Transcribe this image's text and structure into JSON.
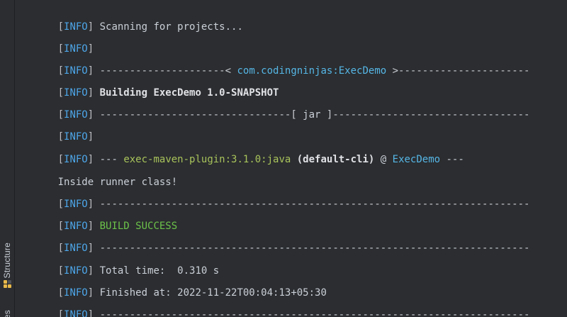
{
  "sidebar": {
    "structure_label": "Structure",
    "partial_label": "es"
  },
  "console": {
    "lines": [
      {
        "tag": "INFO",
        "text": "Scanning for projects..."
      },
      {
        "tag": "INFO"
      },
      {
        "tag": "INFO",
        "dashes_before": "---------------------< ",
        "coord": "com.codingninjas:ExecDemo",
        "dashes_after": " >----------------------"
      },
      {
        "tag": "INFO",
        "bold": "Building ExecDemo 1.0-SNAPSHOT"
      },
      {
        "tag": "INFO",
        "dashes_before": "--------------------------------[ ",
        "packaging": "jar",
        "dashes_after": " ]---------------------------------"
      },
      {
        "tag": "INFO"
      },
      {
        "tag": "INFO",
        "prefix": "--- ",
        "plugin": "exec-maven-plugin:3.1.0:java",
        "execution": " (default-cli)",
        "at": " @ ",
        "project": "ExecDemo",
        "suffix": " ---"
      },
      {
        "text": "Inside runner class!"
      },
      {
        "tag": "INFO",
        "dashes": "------------------------------------------------------------------------"
      },
      {
        "tag": "INFO",
        "status": "BUILD SUCCESS"
      },
      {
        "tag": "INFO",
        "dashes": "------------------------------------------------------------------------"
      },
      {
        "tag": "INFO",
        "text": "Total time:  0.310 s"
      },
      {
        "tag": "INFO",
        "text": "Finished at: 2022-11-22T00:04:13+05:30"
      },
      {
        "tag": "INFO",
        "dashes": "------------------------------------------------------------------------"
      }
    ]
  },
  "colors": {
    "background": "#2b2d30",
    "info_tag": "#4ea6ea",
    "link": "#56b6e6",
    "plugin": "#a9c35b",
    "success": "#6cc24a",
    "text": "#cbd0d8"
  }
}
